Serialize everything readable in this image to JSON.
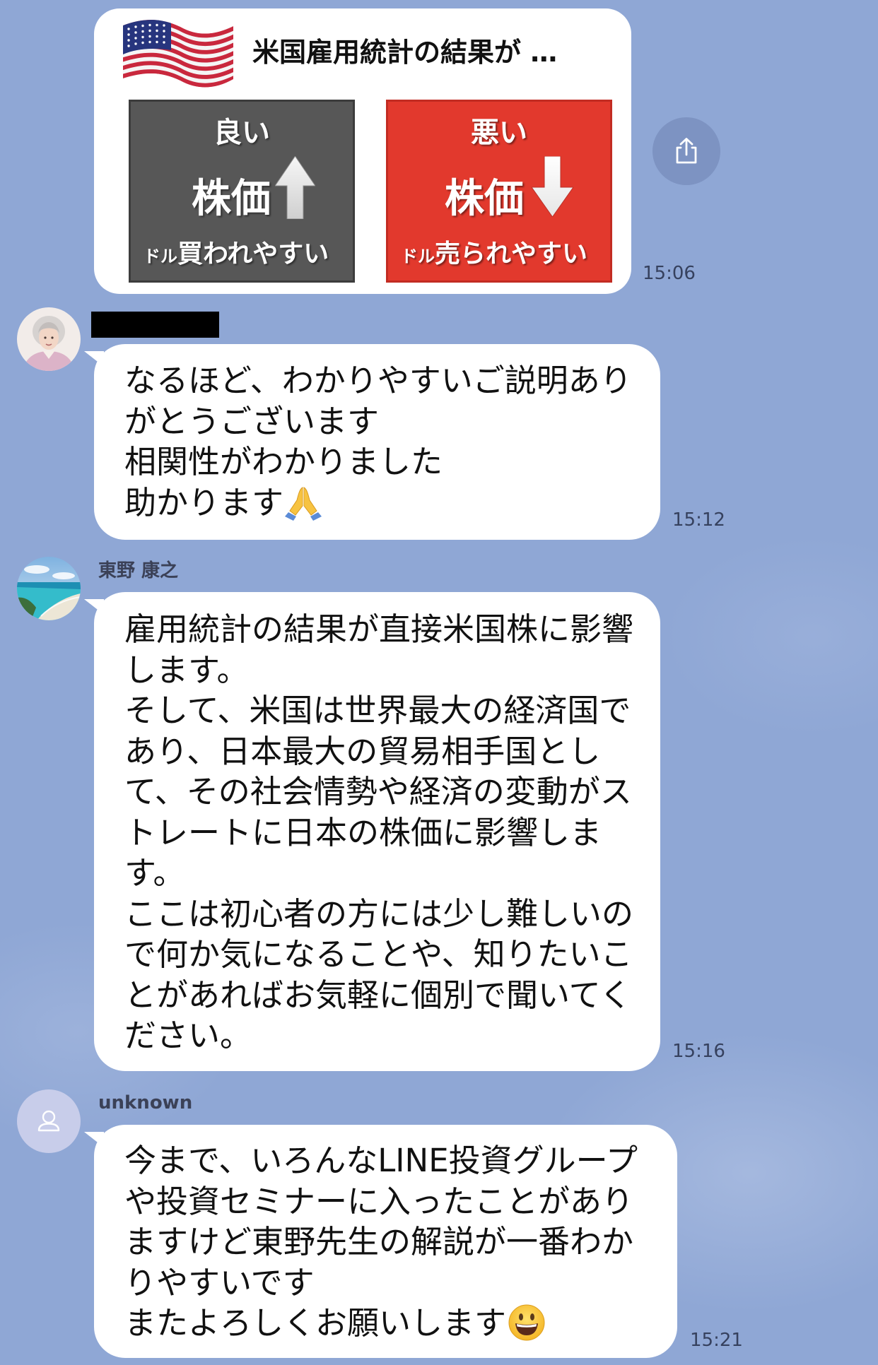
{
  "colors": {
    "background": "#8fa7d5",
    "bubble": "#ffffff",
    "time_text": "#36415e",
    "name_text": "#3b4157",
    "share_button": "#7d93c2"
  },
  "messages": [
    {
      "image_card": {
        "flag_icon": "us-flag-icon",
        "title": "米国雇用統計の結果が …",
        "good": {
          "label": "良い",
          "stock": "株価",
          "dollar_prefix": "ドル",
          "dollar_text": "買われやすい",
          "arrow_icon": "up-arrow-icon",
          "color": "#575757"
        },
        "bad": {
          "label": "悪い",
          "stock": "株価",
          "dollar_prefix": "ドル",
          "dollar_text": "売られやすい",
          "arrow_icon": "down-arrow-icon",
          "color": "#e2392d"
        }
      },
      "share_icon": "share-icon",
      "time": "15:06"
    },
    {
      "sender": {
        "avatar_icon": "elderly-woman-avatar-icon",
        "name_redacted": true
      },
      "lines": [
        "なるほど、わかりやすいご説明あり",
        "がとうございます",
        "相関性がわかりました",
        "助かります"
      ],
      "trailing_emoji_icon": "folded-hands-icon",
      "time": "15:12"
    },
    {
      "sender": {
        "avatar_icon": "beach-photo-avatar-icon",
        "name": "東野 康之"
      },
      "lines": [
        "雇用統計の結果が直接米国株に影響",
        "します。",
        "そして、米国は世界最大の経済国で",
        "あり、日本最大の貿易相手国とし",
        "て、その社会情勢や経済の変動がス",
        "トレートに日本の株価に影響しま",
        "す。",
        "ここは初心者の方には少し難しいの",
        "で何か気になることや、知りたいこ",
        "とがあればお気軽に個別で聞いてく",
        "ださい。"
      ],
      "time": "15:16"
    },
    {
      "sender": {
        "avatar_icon": "default-user-avatar-icon",
        "name": "unknown"
      },
      "lines": [
        "今まで、いろんなLINE投資グループ",
        "や投資セミナーに入ったことがあり",
        "ますけど東野先生の解説が一番わか",
        "りやすいです",
        "またよろしくお願いします"
      ],
      "trailing_emoji_icon": "smiling-face-icon",
      "time": "15:21"
    }
  ]
}
